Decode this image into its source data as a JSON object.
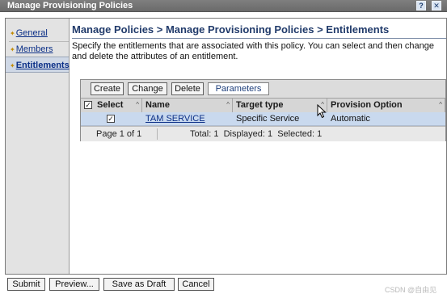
{
  "window": {
    "title": "Manage Provisioning Policies",
    "help_glyph": "?",
    "close_glyph": "✕"
  },
  "sidebar": {
    "items": [
      {
        "label": "General",
        "active": false
      },
      {
        "label": "Members",
        "active": false
      },
      {
        "label": "Entitlements",
        "active": true
      }
    ]
  },
  "main": {
    "breadcrumb_title": "Manage Policies > Manage Provisioning Policies > Entitlements",
    "description": "Specify the entitlements that are associated with this policy. You can select and then change and delete the attributes of an entitlement."
  },
  "toolbar": {
    "create_label": "Create",
    "change_label": "Change",
    "delete_label": "Delete",
    "parameters_label": "Parameters"
  },
  "table": {
    "columns": [
      "Select",
      "Name",
      "Target type",
      "Provision Option"
    ],
    "rows": [
      {
        "selected": true,
        "name": "TAM SERVICE",
        "target_type": "Specific Service",
        "provision_option": "Automatic"
      }
    ],
    "footer": {
      "page": "Page 1 of 1",
      "totals": "Total: 1  Displayed: 1  Selected: 1"
    }
  },
  "actions": {
    "submit_label": "Submit",
    "preview_label": "Preview...",
    "save_draft_label": "Save as Draft",
    "cancel_label": "Cancel"
  },
  "watermark": "CSDN @自由见",
  "colors": {
    "titlebar": "#747474",
    "link": "#0b2f87",
    "heading": "#213b6b",
    "selected_row": "#c9d9ee",
    "sidebar_bg": "#e3e3e3"
  }
}
